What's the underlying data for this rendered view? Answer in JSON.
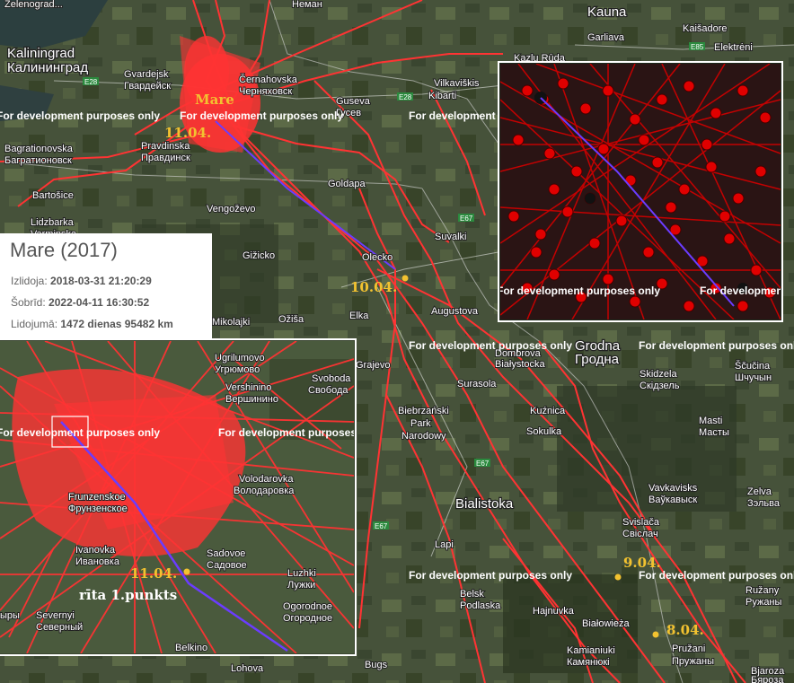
{
  "panel": {
    "title": "Mare (2017)",
    "released_label": "Izlidoja:",
    "released_value": "2018-03-31 21:20:29",
    "today_label": "Šobrīd:",
    "today_value": "2022-04-11 16:30:52",
    "flying_label": "Lidojumā:",
    "flying_value": "1472 dienas 95482 km"
  },
  "watermark": "For development purposes only",
  "bird_name": "Mare",
  "date_labels": {
    "d11": "11.04.",
    "d10": "10.04.",
    "d9": "9.04.",
    "d8": "8.04.",
    "inset_d11": "11.04.",
    "inset_note": "rīta 1.punkts"
  },
  "places": {
    "zelenogradsk": "Zelenograd...",
    "kaliningrad_lat": "Kaliningrad",
    "kaliningrad_ru": "Калининград",
    "gvardejsk_lat": "Gvardejsk",
    "gvardejsk_ru": "Гвардейск",
    "cernahovska_lat": "Černahovska",
    "cernahovska_ru": "Черняховск",
    "neman": "Неман",
    "kauna": "Kauna",
    "kaisadore": "Kaišadore",
    "elektreni": "Elektrėni",
    "garliava": "Garliava",
    "kazlu_ruda": "Kazlu Rūda",
    "vilkaviskis": "Vilkaviškis",
    "kibarti": "Kibarti",
    "guseva_lat": "Guseva",
    "guseva_ru": "Гусев",
    "bagrationovska_lat": "Bagrationovska",
    "bagrationovska_ru": "Багратионовск",
    "pravdinska_lat": "Pravdinska",
    "pravdinska_ru": "Правдинск",
    "bartosice": "Bartošice",
    "lidzbarka": "Lidzbarka",
    "lidzbarka2": "Varmiņska",
    "vengozevo": "Vengoževo",
    "goldapa": "Goldapa",
    "suvalki": "Suvalki",
    "gizicko": "Gižicko",
    "olecko": "Olecko",
    "augustova": "Augustova",
    "elka": "Elka",
    "mikolajki": "Mikolajki",
    "ozisa": "Ožiša",
    "grajevo": "Grajevo",
    "dombrova_lat": "Dombrova",
    "dombrova_pl": "Białystocka",
    "grodna_lat": "Grodna",
    "grodna_ru": "Гродна",
    "skidzela_lat": "Skidzela",
    "skidzela_ru": "Скідзель",
    "scucina_lat": "Ščučina",
    "scucina_ru": "Шчучын",
    "kuznica": "Kuźnica",
    "sokulka": "Sokulka",
    "biebrzanski": "Biebrzański",
    "park": "Park",
    "narodowy": "Narodowy",
    "surazola": "Surasola",
    "bialistoka": "Bialistoka",
    "masti_lat": "Masti",
    "masti_ru": "Масты",
    "vavkaviska_lat": "Vavkavisks",
    "vavkaviska_ru": "Ваўкавыск",
    "zelva_lat": "Zelva",
    "zelva_ru": "Зэльва",
    "svislaca_lat": "Svislača",
    "svislaca_ru": "Свіслач",
    "lapi": "Lapi",
    "belsk_lat": "Belsk",
    "belsk_pl": "Podlaska",
    "hajnuvka": "Hajnuvka",
    "bialowieza": "Białowieża",
    "ruzany_lat": "Ružany",
    "ruzany_ru": "Ружаны",
    "kamianiuki_lat": "Kamianiuki",
    "kamianiuki_ru": "Камянюкі",
    "pruzani_lat": "Pružani",
    "pruzani_ru": "Пружаны",
    "bjaroza_lat": "Bjaroza",
    "bjaroza_ru": "Бяроза",
    "lohova": "Lohova",
    "bugs": "Bugs"
  },
  "inset_places": {
    "ugrilumovo_lat": "Ugrilumovo",
    "ugrilumovo_ru": "Угрюмово",
    "svoboda_lat": "Svoboda",
    "svoboda_ru": "Свобода",
    "vershinino_lat": "Vershinino",
    "vershinino_ru": "Вершинино",
    "frunzenskoe_lat": "Frunzenskoe",
    "frunzenskoe_ru": "Фрунзенское",
    "volodarovka_lat": "Volodarovka",
    "volodarovka_ru": "Володаровка",
    "ivanovka_lat": "Ivanovka",
    "ivanovka_ru": "Ивановка",
    "sadovoe_lat": "Sadovoe",
    "sadovoe_ru": "Садовое",
    "luzhki_lat": "Luzhki",
    "luzhki_ru": "Лужки",
    "ogorodnoe_lat": "Ogorodnoe",
    "ogorodnoe_ru": "Огородное",
    "severnyi_lat": "Severnyi",
    "severnyi_ru": "Северный",
    "belkino": "Belkino",
    "ryb": "ыры"
  },
  "roads": {
    "e28a": "E28",
    "e28b": "E28",
    "e85": "E85",
    "e67a": "E67",
    "e67b": "E67",
    "e67c": "E67"
  },
  "colors": {
    "track": "#ff3333",
    "route": "#6b3cff",
    "marker": "#f2c230",
    "inset_track": "#cc0000"
  }
}
